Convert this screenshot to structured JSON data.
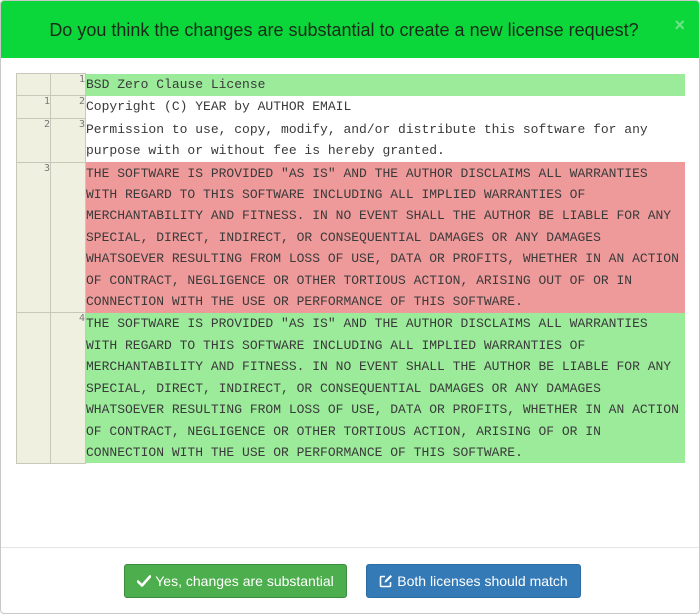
{
  "modal": {
    "title": "Do you think the changes are substantial to create a new license request?",
    "close_symbol": "×"
  },
  "diff": {
    "rows": [
      {
        "type": "added",
        "left_num": "",
        "right_num": "1",
        "text": "BSD Zero Clause License"
      },
      {
        "type": "equal",
        "left_num": "1",
        "right_num": "2",
        "text": "Copyright (C) YEAR by AUTHOR EMAIL"
      },
      {
        "type": "equal",
        "left_num": "2",
        "right_num": "3",
        "text": "Permission to use, copy, modify, and/or distribute this software for any purpose with or without fee is hereby granted."
      },
      {
        "type": "removed",
        "left_num": "3",
        "right_num": "",
        "text": "THE SOFTWARE IS PROVIDED \"AS IS\" AND THE AUTHOR DISCLAIMS ALL WARRANTIES WITH REGARD TO THIS SOFTWARE INCLUDING ALL IMPLIED WARRANTIES OF MERCHANTABILITY AND FITNESS. IN NO EVENT SHALL THE AUTHOR BE LIABLE FOR ANY SPECIAL, DIRECT, INDIRECT, OR CONSEQUENTIAL DAMAGES OR ANY DAMAGES WHATSOEVER RESULTING FROM LOSS OF USE, DATA OR PROFITS, WHETHER IN AN ACTION OF CONTRACT, NEGLIGENCE OR OTHER TORTIOUS ACTION, ARISING OUT OF OR IN CONNECTION WITH THE USE OR PERFORMANCE OF THIS SOFTWARE."
      },
      {
        "type": "added",
        "left_num": "",
        "right_num": "4",
        "text": "THE SOFTWARE IS PROVIDED \"AS IS\" AND THE AUTHOR DISCLAIMS ALL WARRANTIES WITH REGARD TO THIS SOFTWARE INCLUDING ALL IMPLIED WARRANTIES OF MERCHANTABILITY AND FITNESS. IN NO EVENT SHALL THE AUTHOR BE LIABLE FOR ANY SPECIAL, DIRECT, INDIRECT, OR CONSEQUENTIAL DAMAGES OR ANY DAMAGES WHATSOEVER RESULTING FROM LOSS OF USE, DATA OR PROFITS, WHETHER IN AN ACTION OF CONTRACT, NEGLIGENCE OR OTHER TORTIOUS ACTION, ARISING OF OR IN CONNECTION WITH THE USE OR PERFORMANCE OF THIS SOFTWARE."
      }
    ]
  },
  "footer": {
    "yes_button": {
      "label": "Yes, changes are substantial",
      "icon": "check-icon"
    },
    "match_button": {
      "label": "Both licenses should match",
      "icon": "edit-icon"
    }
  },
  "colors": {
    "header_bg": "#0bd63a",
    "added_bg": "#9beb9b",
    "removed_bg": "#ef9a9a",
    "success_button": "#4cae4c",
    "primary_button": "#337ab7"
  }
}
